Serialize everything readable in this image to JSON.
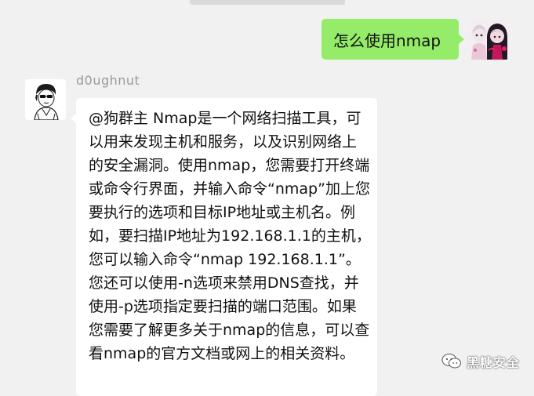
{
  "chat": {
    "messages": [
      {
        "side": "right",
        "text": "怎么使用nmap",
        "bubble_color": "#95ec69"
      },
      {
        "side": "left",
        "sender": "d0ughnut",
        "text": "@狗群主 Nmap是一个网络扫描工具，可以用来发现主机和服务，以及识别网络上的安全漏洞。使用nmap，您需要打开终端或命令行界面，并输入命令“nmap”加上您要执行的选项和目标IP地址或主机名。例如，要扫描IP地址为192.168.1.1的主机，您可以输入命令“nmap 192.168.1.1”。您还可以使用-n选项来禁用DNS查找，并使用-p选项指定要扫描的端口范围。如果您需要了解更多关于nmap的信息，可以查看nmap的官方文档或网上的相关资料。",
        "bubble_color": "#ffffff"
      }
    ]
  },
  "watermark": {
    "text": "黑糖安全",
    "icon": "wechat-official-account-icon"
  },
  "colors": {
    "background": "#f1f1f1",
    "sender_name": "#9a9a9a"
  }
}
